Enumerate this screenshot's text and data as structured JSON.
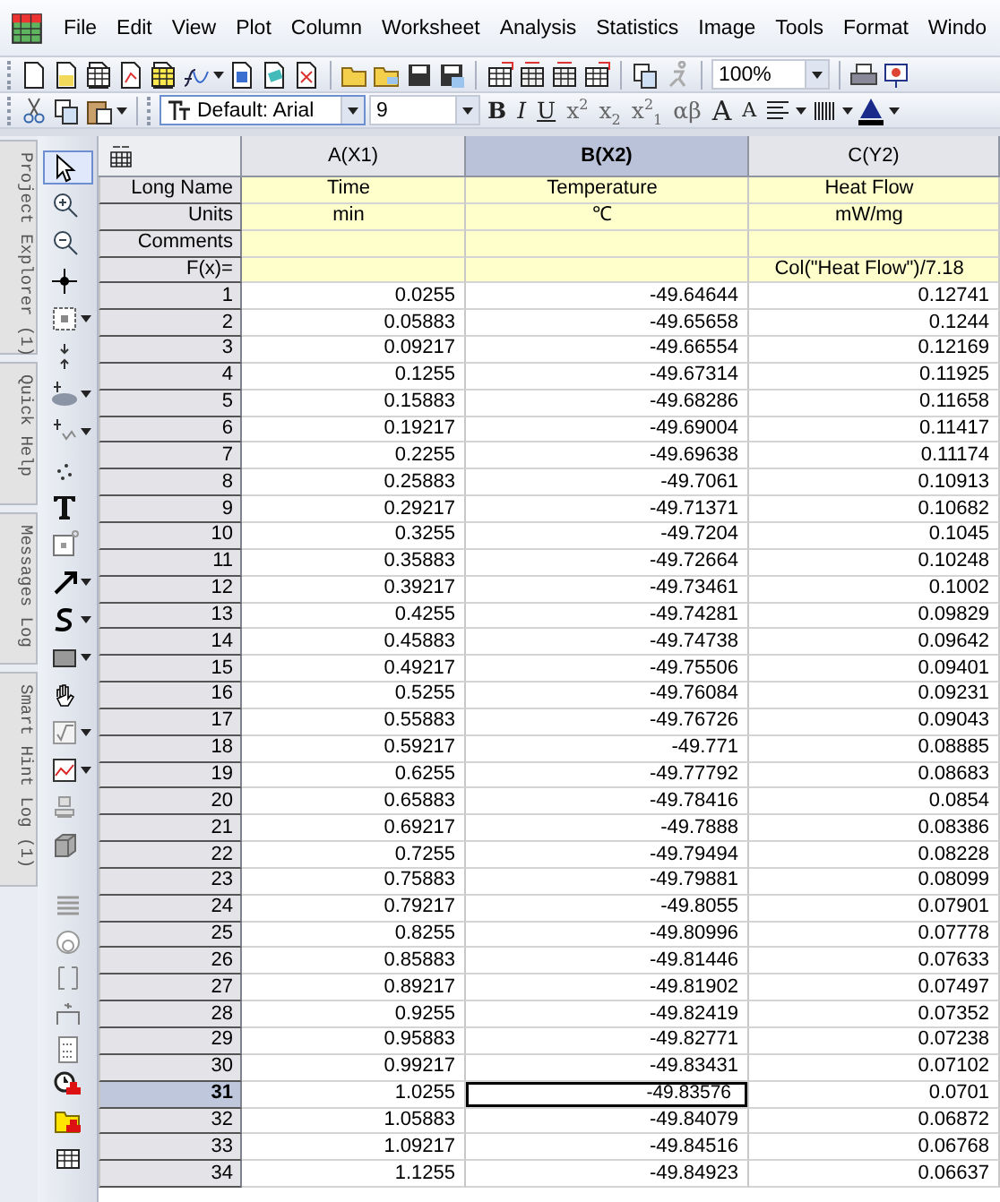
{
  "menu": [
    "File",
    "Edit",
    "View",
    "Plot",
    "Column",
    "Worksheet",
    "Analysis",
    "Statistics",
    "Image",
    "Tools",
    "Format",
    "Windo"
  ],
  "standard_toolbar": {
    "zoom": "100%"
  },
  "format_toolbar": {
    "font": "Default: Arial",
    "size": "9",
    "buttons": [
      {
        "label": "B",
        "kind": "bold"
      },
      {
        "label": "I",
        "kind": "italic"
      },
      {
        "label": "U",
        "kind": "underline"
      },
      {
        "label": "x$^{2}$",
        "kind": "plain"
      },
      {
        "label": "x$_{2}$",
        "kind": "plain"
      },
      {
        "label": "x$^{2}$$_{1}$",
        "kind": "plain"
      },
      {
        "label": "αβ",
        "kind": "plain"
      },
      {
        "label": "A",
        "kind": "grow"
      },
      {
        "label": "A",
        "kind": "shrink"
      }
    ]
  },
  "side_tabs": [
    "Project Explorer (1)",
    "Quick Help",
    "Messages Log",
    "Smart Hint Log (1)"
  ],
  "tools": [
    {
      "selected": true
    },
    {
      "selected": false
    },
    {
      "selected": false
    },
    {
      "selected": false
    },
    {
      "selected": false
    },
    {
      "selected": false
    },
    {
      "selected": false
    },
    {
      "selected": false
    },
    {
      "selected": false
    },
    {
      "selected": false
    },
    {
      "selected": false
    },
    {
      "selected": false
    },
    {
      "selected": false
    },
    {
      "selected": false
    },
    {
      "selected": false
    },
    {
      "selected": false
    },
    {
      "selected": false
    },
    {
      "selected": false
    },
    {
      "selected": false
    }
  ],
  "table": {
    "meta_labels": [
      "Long Name",
      "Units",
      "Comments",
      "F(x)="
    ],
    "columns": [
      {
        "label": "A(X1)",
        "selected": false,
        "long_name": "Time",
        "units": "min"
      },
      {
        "label": "B(X2)",
        "selected": true,
        "long_name": "Temperature",
        "units": "℃"
      },
      {
        "label": "C(Y2)",
        "selected": false,
        "long_name": "Heat Flow",
        "units": "mW/mg",
        "formula": "Col(\"Heat Flow\")/7.18"
      }
    ],
    "rows": [
      {
        "label": "1",
        "selected": false,
        "cells": [
          "0.0255",
          "-49.64644",
          "0.12741"
        ]
      },
      {
        "label": "2",
        "selected": false,
        "cells": [
          "0.05883",
          "-49.65658",
          "0.1244"
        ]
      },
      {
        "label": "3",
        "selected": false,
        "cells": [
          "0.09217",
          "-49.66554",
          "0.12169"
        ]
      },
      {
        "label": "4",
        "selected": false,
        "cells": [
          "0.1255",
          "-49.67314",
          "0.11925"
        ]
      },
      {
        "label": "5",
        "selected": false,
        "cells": [
          "0.15883",
          "-49.68286",
          "0.11658"
        ]
      },
      {
        "label": "6",
        "selected": false,
        "cells": [
          "0.19217",
          "-49.69004",
          "0.11417"
        ]
      },
      {
        "label": "7",
        "selected": false,
        "cells": [
          "0.2255",
          "-49.69638",
          "0.11174"
        ]
      },
      {
        "label": "8",
        "selected": false,
        "cells": [
          "0.25883",
          "-49.7061",
          "0.10913"
        ]
      },
      {
        "label": "9",
        "selected": false,
        "cells": [
          "0.29217",
          "-49.71371",
          "0.10682"
        ]
      },
      {
        "label": "10",
        "selected": false,
        "cells": [
          "0.3255",
          "-49.7204",
          "0.1045"
        ]
      },
      {
        "label": "11",
        "selected": false,
        "cells": [
          "0.35883",
          "-49.72664",
          "0.10248"
        ]
      },
      {
        "label": "12",
        "selected": false,
        "cells": [
          "0.39217",
          "-49.73461",
          "0.1002"
        ]
      },
      {
        "label": "13",
        "selected": false,
        "cells": [
          "0.4255",
          "-49.74281",
          "0.09829"
        ]
      },
      {
        "label": "14",
        "selected": false,
        "cells": [
          "0.45883",
          "-49.74738",
          "0.09642"
        ]
      },
      {
        "label": "15",
        "selected": false,
        "cells": [
          "0.49217",
          "-49.75506",
          "0.09401"
        ]
      },
      {
        "label": "16",
        "selected": false,
        "cells": [
          "0.5255",
          "-49.76084",
          "0.09231"
        ]
      },
      {
        "label": "17",
        "selected": false,
        "cells": [
          "0.55883",
          "-49.76726",
          "0.09043"
        ]
      },
      {
        "label": "18",
        "selected": false,
        "cells": [
          "0.59217",
          "-49.771",
          "0.08885"
        ]
      },
      {
        "label": "19",
        "selected": false,
        "cells": [
          "0.6255",
          "-49.77792",
          "0.08683"
        ]
      },
      {
        "label": "20",
        "selected": false,
        "cells": [
          "0.65883",
          "-49.78416",
          "0.0854"
        ]
      },
      {
        "label": "21",
        "selected": false,
        "cells": [
          "0.69217",
          "-49.7888",
          "0.08386"
        ]
      },
      {
        "label": "22",
        "selected": false,
        "cells": [
          "0.7255",
          "-49.79494",
          "0.08228"
        ]
      },
      {
        "label": "23",
        "selected": false,
        "cells": [
          "0.75883",
          "-49.79881",
          "0.08099"
        ]
      },
      {
        "label": "24",
        "selected": false,
        "cells": [
          "0.79217",
          "-49.8055",
          "0.07901"
        ]
      },
      {
        "label": "25",
        "selected": false,
        "cells": [
          "0.8255",
          "-49.80996",
          "0.07778"
        ]
      },
      {
        "label": "26",
        "selected": false,
        "cells": [
          "0.85883",
          "-49.81446",
          "0.07633"
        ]
      },
      {
        "label": "27",
        "selected": false,
        "cells": [
          "0.89217",
          "-49.81902",
          "0.07497"
        ]
      },
      {
        "label": "28",
        "selected": false,
        "cells": [
          "0.9255",
          "-49.82419",
          "0.07352"
        ]
      },
      {
        "label": "29",
        "selected": false,
        "cells": [
          "0.95883",
          "-49.82771",
          "0.07238"
        ]
      },
      {
        "label": "30",
        "selected": false,
        "cells": [
          "0.99217",
          "-49.83431",
          "0.07102"
        ]
      },
      {
        "label": "31",
        "selected": true,
        "cells": [
          "1.0255",
          "-49.83576",
          "0.0701"
        ]
      },
      {
        "label": "32",
        "selected": false,
        "cells": [
          "1.05883",
          "-49.84079",
          "0.06872"
        ]
      },
      {
        "label": "33",
        "selected": false,
        "cells": [
          "1.09217",
          "-49.84516",
          "0.06768"
        ]
      },
      {
        "label": "34",
        "selected": false,
        "cells": [
          "1.1255",
          "-49.84923",
          "0.06637"
        ]
      }
    ]
  }
}
